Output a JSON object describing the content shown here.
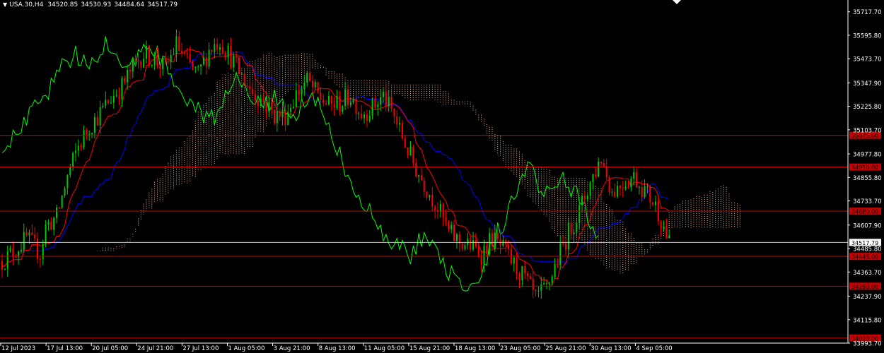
{
  "header": {
    "symbol": "USA.30,H4",
    "open": "34520.85",
    "high": "34530.93",
    "low": "34484.64",
    "close": "34517.79"
  },
  "colors": {
    "background": "#000000",
    "bull": "#00c800",
    "bear": "#ff0000",
    "tenkan": "#ff0000",
    "kijun": "#0000ff",
    "chikou": "#00ff00",
    "cloud": "#f0b49c",
    "level_line": "#d20000",
    "level_label_bg": "#c80000",
    "price_line": "#c8c8c8"
  },
  "chart_data": {
    "type": "candlestick",
    "title": "USA.30,H4",
    "indicator": "Ichimoku Kinko Hyo",
    "y_range": [
      33993.7,
      35779.0
    ],
    "y_ticks": [
      "35717.70",
      "35595.80",
      "35473.70",
      "35347.90",
      "35225.80",
      "35103.70",
      "34977.80",
      "34855.80",
      "34733.70",
      "34607.90",
      "34485.80",
      "34363.70",
      "34237.90",
      "34115.80",
      "33993.70"
    ],
    "x_ticks": [
      "12 Jul 2023",
      "17 Jul 13:00",
      "20 Jul 05:00",
      "24 Jul 21:00",
      "27 Jul 13:00",
      "1 Aug 05:00",
      "3 Aug 21:00",
      "8 Aug 13:00",
      "11 Aug 05:00",
      "15 Aug 21:00",
      "18 Aug 13:00",
      "23 Aug 05:00",
      "25 Aug 21:00",
      "30 Aug 13:00",
      "4 Sep 05:00"
    ],
    "current_price": "34517.79",
    "levels": [
      "35075.00",
      "34910.00",
      "34680.00",
      "34445.00",
      "34290.00",
      "34020.00"
    ],
    "anchors": [
      [
        0,
        34420
      ],
      [
        5,
        34480
      ],
      [
        9,
        34540
      ],
      [
        14,
        34460
      ],
      [
        16,
        34600
      ],
      [
        20,
        34650
      ],
      [
        24,
        34860
      ],
      [
        28,
        35020
      ],
      [
        32,
        35120
      ],
      [
        36,
        35190
      ],
      [
        40,
        35270
      ],
      [
        44,
        35330
      ],
      [
        48,
        35430
      ],
      [
        52,
        35500
      ],
      [
        56,
        35470
      ],
      [
        60,
        35420
      ],
      [
        64,
        35550
      ],
      [
        68,
        35450
      ],
      [
        72,
        35390
      ],
      [
        76,
        35520
      ],
      [
        80,
        35570
      ],
      [
        84,
        35480
      ],
      [
        88,
        35380
      ],
      [
        92,
        35300
      ],
      [
        96,
        35250
      ],
      [
        100,
        35180
      ],
      [
        104,
        35180
      ],
      [
        108,
        35290
      ],
      [
        112,
        35360
      ],
      [
        116,
        35280
      ],
      [
        120,
        35230
      ],
      [
        124,
        35240
      ],
      [
        128,
        35280
      ],
      [
        132,
        35190
      ],
      [
        136,
        35220
      ],
      [
        140,
        35280
      ],
      [
        144,
        35170
      ],
      [
        148,
        35030
      ],
      [
        152,
        34900
      ],
      [
        156,
        34800
      ],
      [
        160,
        34700
      ],
      [
        164,
        34570
      ],
      [
        168,
        34520
      ],
      [
        172,
        34500
      ],
      [
        176,
        34460
      ],
      [
        180,
        34540
      ],
      [
        184,
        34480
      ],
      [
        188,
        34400
      ],
      [
        192,
        34330
      ],
      [
        196,
        34220
      ],
      [
        200,
        34280
      ],
      [
        204,
        34430
      ],
      [
        208,
        34570
      ],
      [
        212,
        34680
      ],
      [
        216,
        34830
      ],
      [
        220,
        34960
      ],
      [
        224,
        34780
      ],
      [
        228,
        34830
      ],
      [
        232,
        34860
      ],
      [
        236,
        34790
      ],
      [
        240,
        34710
      ],
      [
        243,
        34600
      ],
      [
        245,
        34510
      ]
    ]
  }
}
